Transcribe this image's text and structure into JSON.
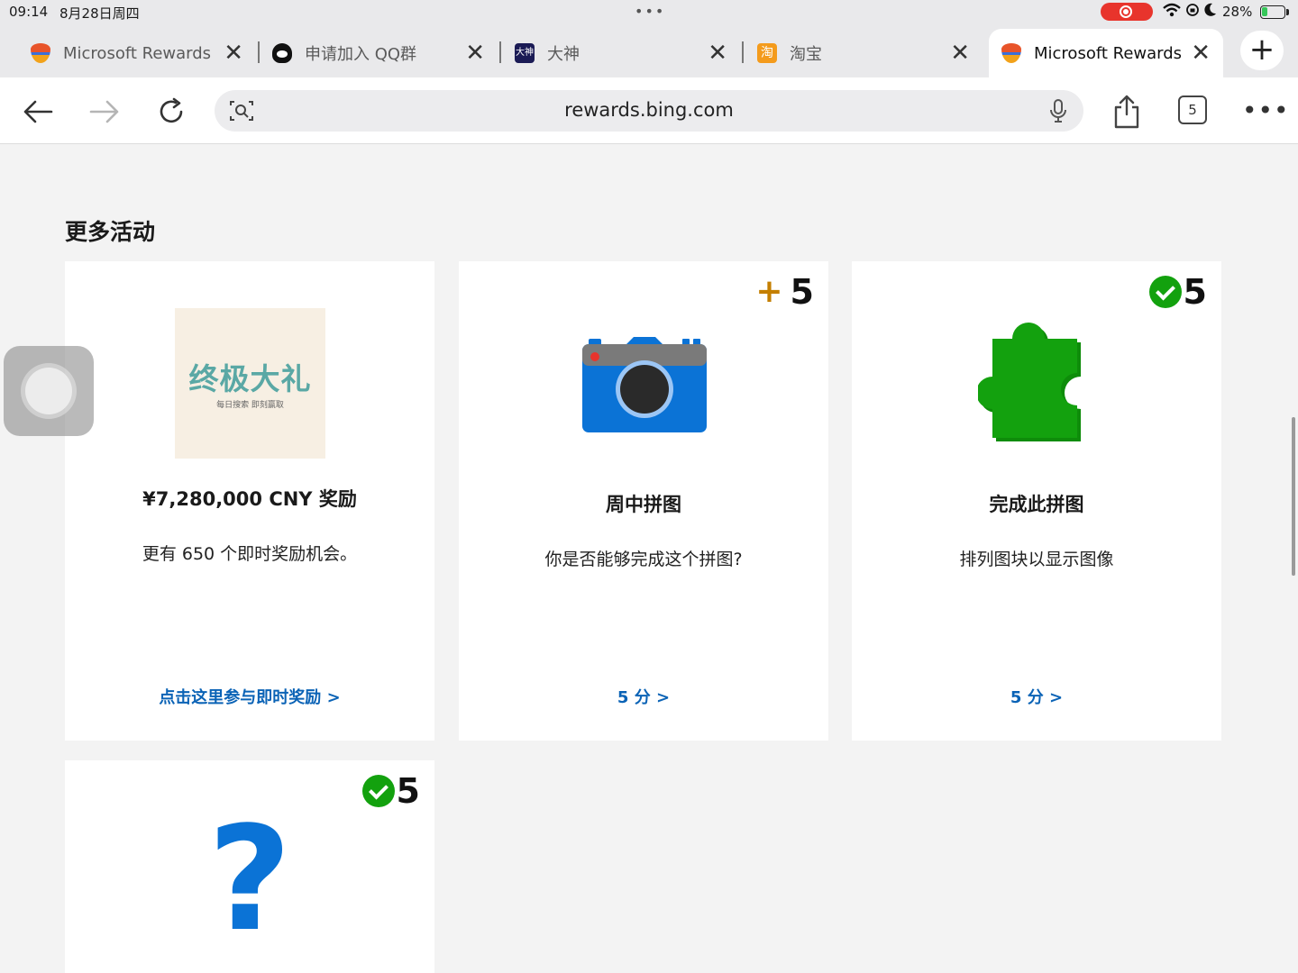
{
  "status": {
    "time": "09:14",
    "date": "8月28日周四",
    "battery": "28%",
    "battery_level": 0.28,
    "icons": [
      "wifi-icon",
      "lock-rotation-icon",
      "moon-icon"
    ]
  },
  "tabs": [
    {
      "title": "Microsoft Rewards",
      "favicon": "rewards-medal-icon"
    },
    {
      "title": "申请加入 QQ群",
      "favicon": "qq-penguin-icon"
    },
    {
      "title": "大神",
      "favicon": "dashen-icon",
      "favicon_text": "大神"
    },
    {
      "title": "淘宝",
      "favicon": "taobao-icon",
      "favicon_text": "淘"
    },
    {
      "title": "Microsoft Rewards",
      "favicon": "rewards-medal-icon",
      "active": true
    }
  ],
  "toolbar": {
    "url": "rewards.bing.com",
    "tab_count": "5"
  },
  "section": {
    "title": "更多活动"
  },
  "cards": [
    {
      "image_title": "终极大礼",
      "image_subtitle": "每日搜索 即刻赢取",
      "title": "¥7,280,000 CNY 奖励",
      "desc": "更有 650 个即时奖励机会。",
      "link": "点击这里参与即时奖励 >"
    },
    {
      "points": "5",
      "status": "available",
      "icon": "camera-icon",
      "title": "周中拼图",
      "desc": "你是否能够完成这个拼图?",
      "link": "5 分 >"
    },
    {
      "points": "5",
      "status": "completed",
      "icon": "puzzle-piece-icon",
      "title": "完成此拼图",
      "desc": "排列图块以显示图像",
      "link": "5 分 >"
    },
    {
      "points": "5",
      "status": "completed",
      "icon": "question-mark-icon",
      "glyph": "?"
    }
  ],
  "colors": {
    "link": "#0b63b6",
    "completed": "#13a10e",
    "plus": "#c47f00",
    "camera": "#0b73d6",
    "puzzle": "#13a10e"
  }
}
